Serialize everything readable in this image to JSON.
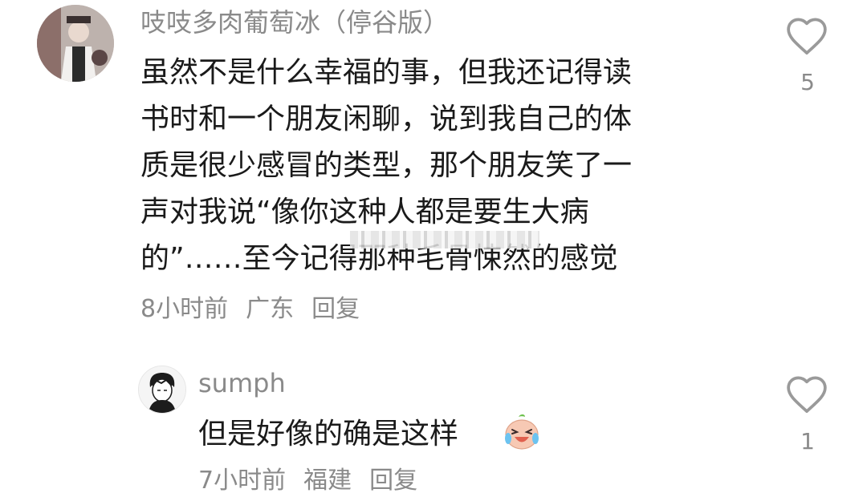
{
  "comments": [
    {
      "username": "吱吱多肉葡萄冰（停谷版）",
      "lines": [
        "虽然不是什么幸福的事，但我还记得读",
        "书时和一个朋友闲聊，说到我自己的体",
        "质是很少感冒的类型，那个朋友笑了一",
        "声对我说“像你这种人都是要生大病",
        "的”……至今记得那种毛骨悚然的感觉"
      ],
      "time": "8小时前",
      "location": "广东",
      "reply_label": "回复",
      "likes": "5"
    },
    {
      "username": "sumph",
      "text": "但是好像的确是这样",
      "emoji_icon": "crying-laughing-emoji-icon",
      "time": "7小时前",
      "location": "福建",
      "reply_label": "回复",
      "likes": "1"
    }
  ],
  "icons": {
    "like": "heart-outline-icon"
  },
  "colors": {
    "secondary_text": "#8a8a8a",
    "primary_text": "#1a1a1a",
    "background": "#ffffff"
  }
}
